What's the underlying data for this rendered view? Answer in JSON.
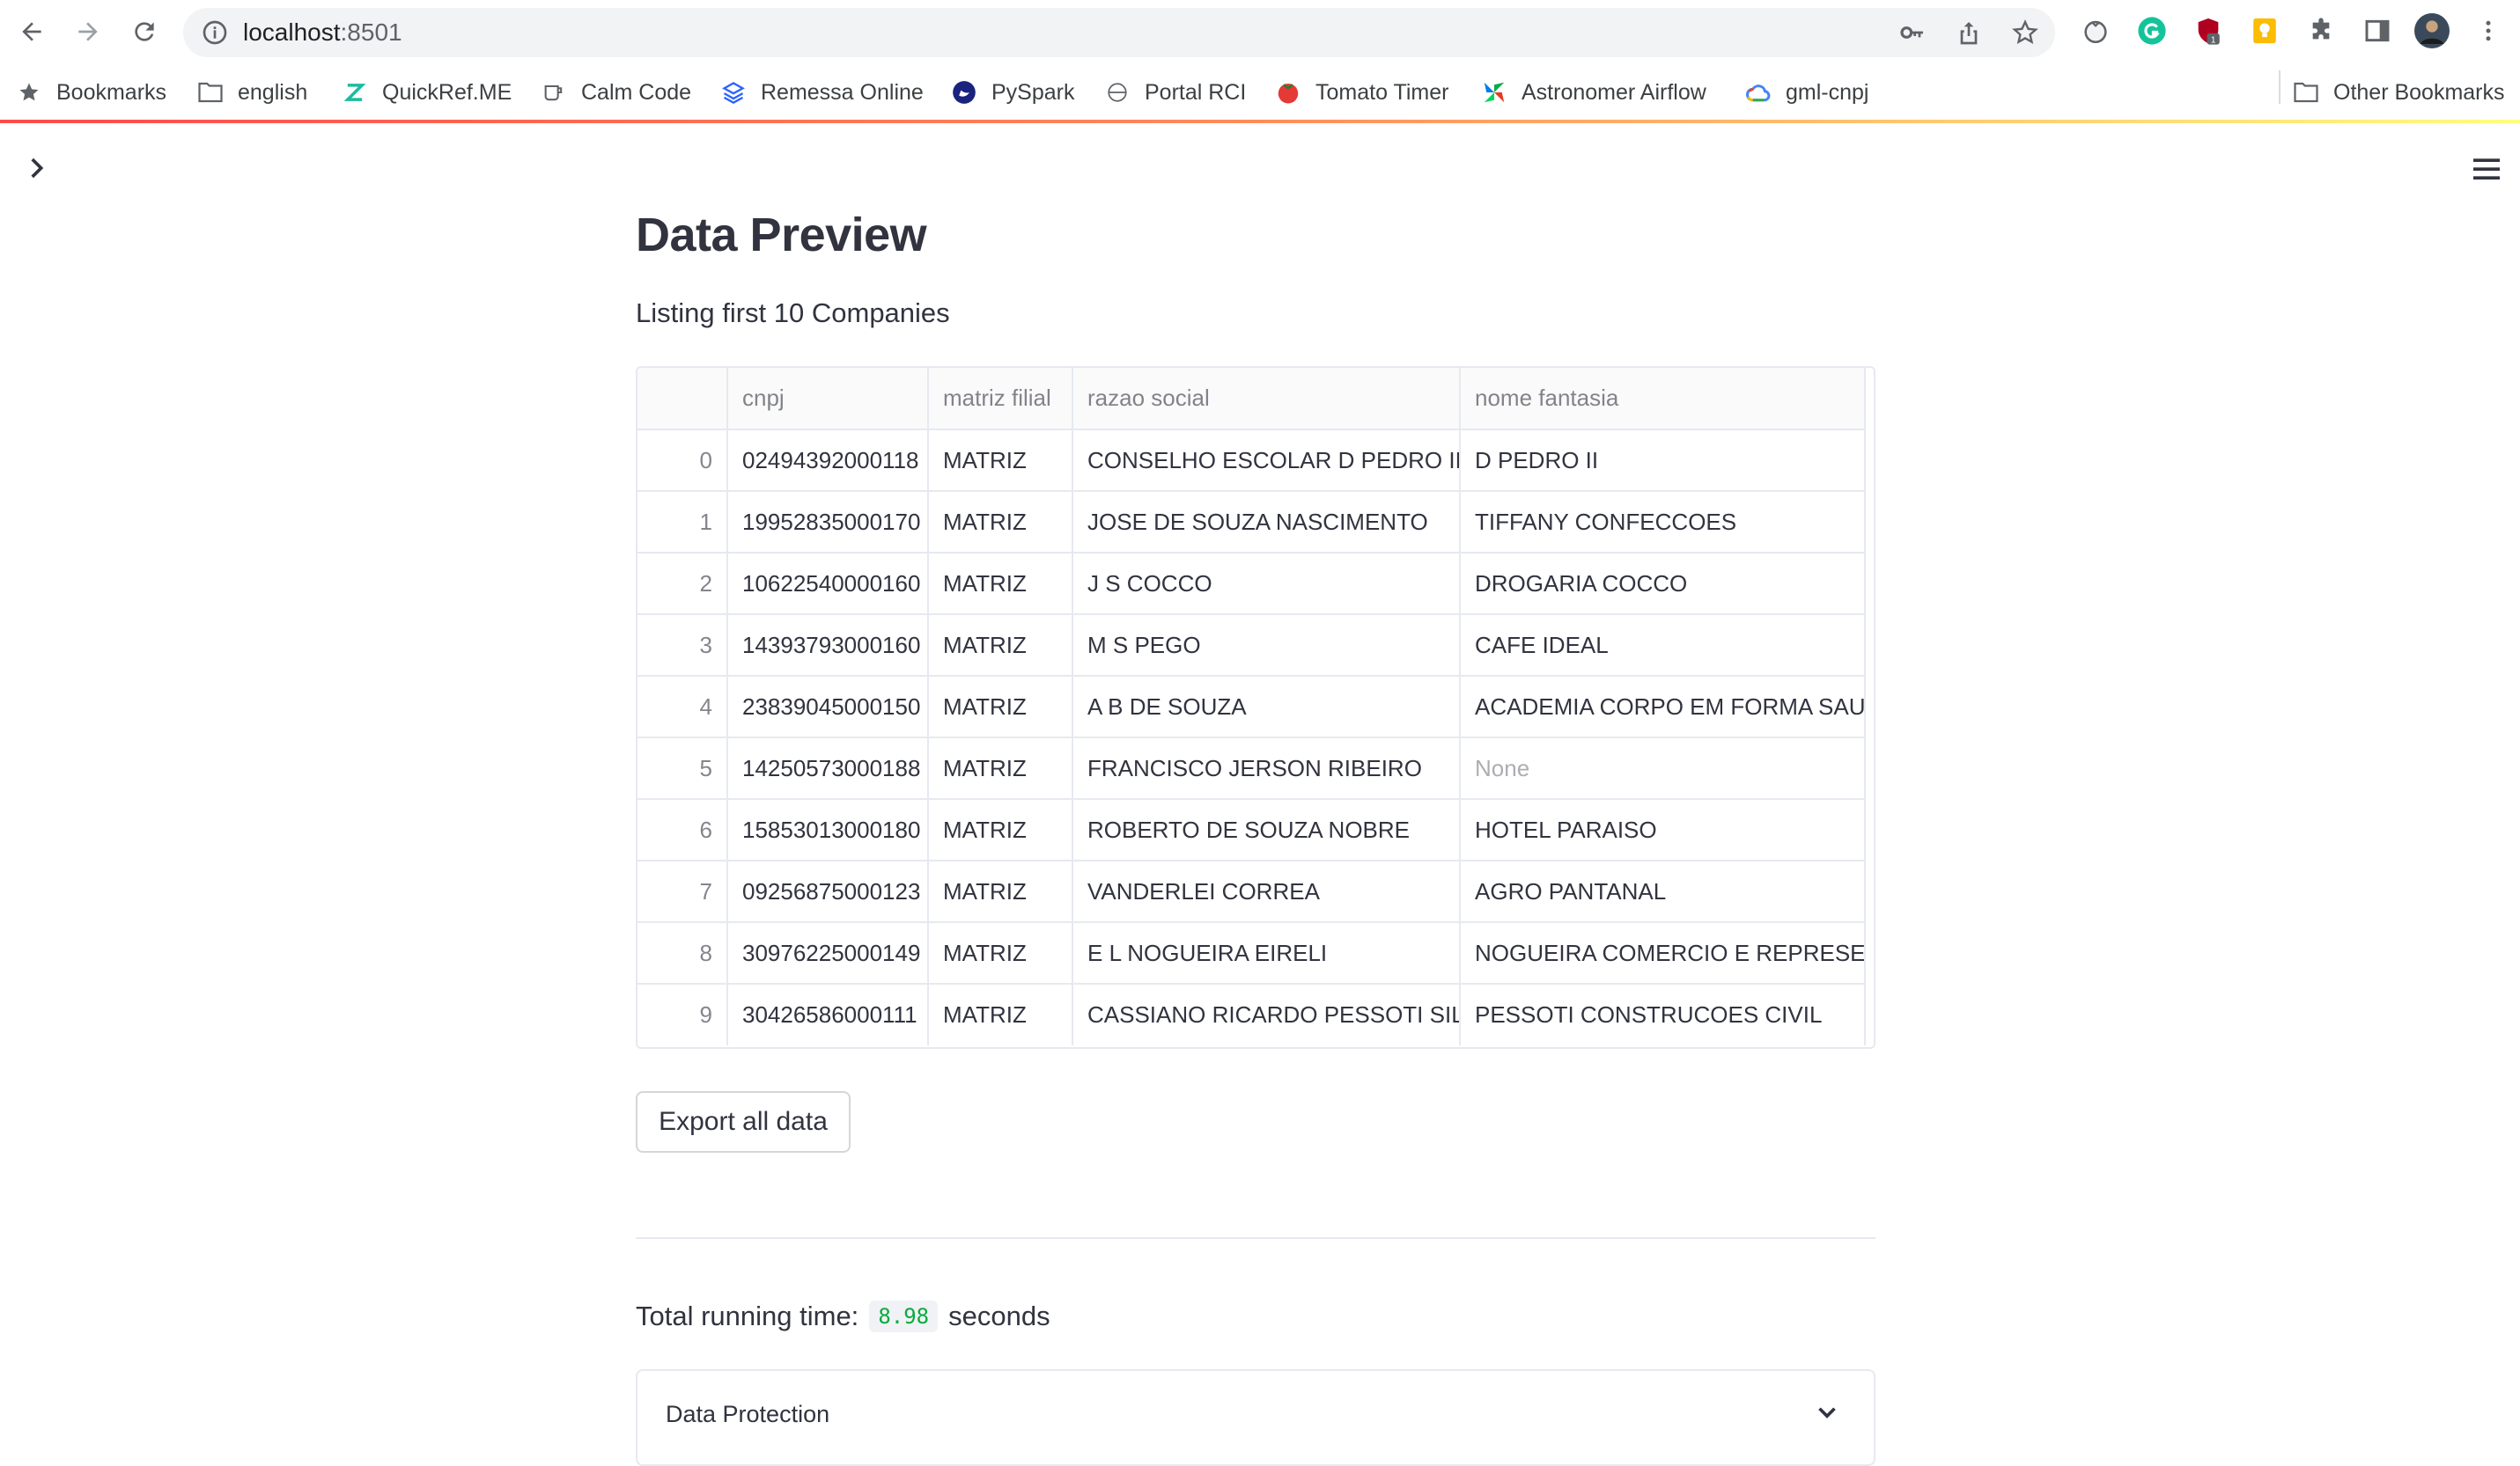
{
  "browser": {
    "url_host": "localhost",
    "url_port": ":8501",
    "extension_badge": "1"
  },
  "bookmarks": {
    "items": [
      {
        "label": "Bookmarks",
        "icon": "star-icon"
      },
      {
        "label": "english",
        "icon": "folder-icon"
      },
      {
        "label": "QuickRef.ME",
        "icon": "quickref-icon"
      },
      {
        "label": "Calm Code",
        "icon": "calmcode-icon"
      },
      {
        "label": "Remessa Online",
        "icon": "remessa-icon"
      },
      {
        "label": "PySpark",
        "icon": "pyspark-icon"
      },
      {
        "label": "Portal RCI",
        "icon": "globe-icon"
      },
      {
        "label": "Tomato Timer",
        "icon": "tomato-icon"
      },
      {
        "label": "Astronomer Airflow",
        "icon": "airflow-icon"
      },
      {
        "label": "gml-cnpj",
        "icon": "gcloud-icon"
      }
    ],
    "other": "Other Bookmarks"
  },
  "page": {
    "title": "Data Preview",
    "subtitle": "Listing first 10 Companies",
    "export_label": "Export all data",
    "running_prefix": "Total running time:",
    "running_value": "8.98",
    "running_suffix": "seconds",
    "expander_label": "Data Protection"
  },
  "table": {
    "columns": [
      "",
      "cnpj",
      "matriz filial",
      "razao social",
      "nome fantasia"
    ],
    "rows": [
      [
        "0",
        "02494392000118",
        "MATRIZ",
        "CONSELHO ESCOLAR D PEDRO II",
        "D PEDRO II"
      ],
      [
        "1",
        "19952835000170",
        "MATRIZ",
        "JOSE DE SOUZA NASCIMENTO",
        "TIFFANY CONFECCOES"
      ],
      [
        "2",
        "10622540000160",
        "MATRIZ",
        "J S COCCO",
        "DROGARIA COCCO"
      ],
      [
        "3",
        "14393793000160",
        "MATRIZ",
        "M S PEGO",
        "CAFE IDEAL"
      ],
      [
        "4",
        "23839045000150",
        "MATRIZ",
        "A B DE SOUZA",
        "ACADEMIA CORPO EM FORMA SAUDE"
      ],
      [
        "5",
        "14250573000188",
        "MATRIZ",
        "FRANCISCO JERSON RIBEIRO",
        "None"
      ],
      [
        "6",
        "15853013000180",
        "MATRIZ",
        "ROBERTO DE SOUZA NOBRE",
        "HOTEL PARAISO"
      ],
      [
        "7",
        "09256875000123",
        "MATRIZ",
        "VANDERLEI CORREA",
        "AGRO PANTANAL"
      ],
      [
        "8",
        "30976225000149",
        "MATRIZ",
        "E L NOGUEIRA EIRELI",
        "NOGUEIRA COMERCIO E REPRESENTAC"
      ],
      [
        "9",
        "30426586000111",
        "MATRIZ",
        "CASSIANO RICARDO PESSOTI SILVA",
        "PESSOTI CONSTRUCOES CIVIL"
      ]
    ]
  },
  "colors": {
    "accent": "#ff4b4b",
    "code_green": "#09ab3b"
  }
}
